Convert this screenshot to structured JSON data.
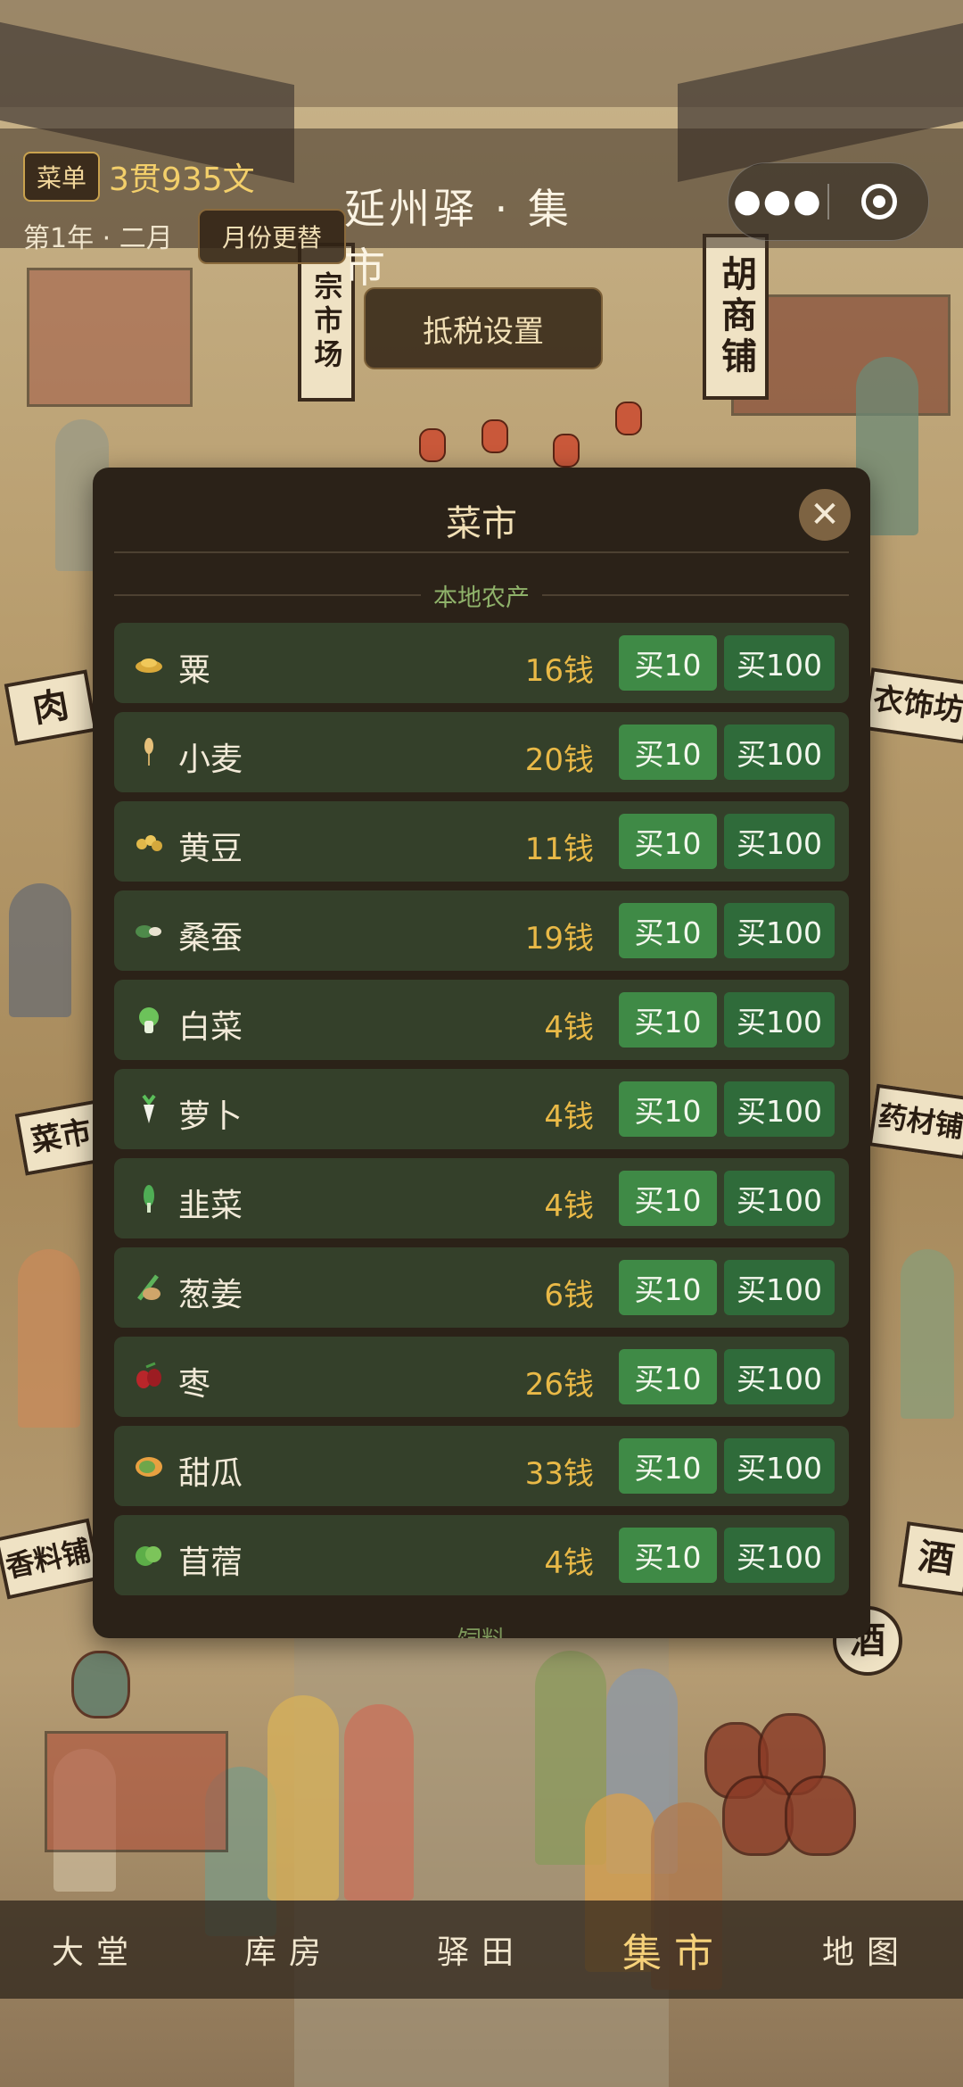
{
  "header": {
    "menu_label": "菜单",
    "money": "3贯935文",
    "date": "第1年 · 二月",
    "month_button": "月份更替",
    "title": "延州驿 · 集 市",
    "more_icon": "more-dots-icon",
    "target_icon": "record-target-icon"
  },
  "tax_button": "抵税设置",
  "background_signs": [
    "宗市场",
    "胡商铺",
    "肉",
    "衣饰坊",
    "菜市",
    "药材铺",
    "香料铺",
    "酒",
    "酒"
  ],
  "modal": {
    "title": "菜市",
    "close_icon": "close-icon",
    "section_local": "本地农产",
    "section_feed": "饲料",
    "buy10_label": "买10",
    "buy100_label": "买100",
    "items": [
      {
        "name": "粟",
        "price": "16钱",
        "icon": "millet-icon"
      },
      {
        "name": "小麦",
        "price": "20钱",
        "icon": "wheat-icon"
      },
      {
        "name": "黄豆",
        "price": "11钱",
        "icon": "soybean-icon"
      },
      {
        "name": "桑蚕",
        "price": "19钱",
        "icon": "silkworm-icon"
      },
      {
        "name": "白菜",
        "price": "4钱",
        "icon": "cabbage-icon"
      },
      {
        "name": "萝卜",
        "price": "4钱",
        "icon": "radish-icon"
      },
      {
        "name": "韭菜",
        "price": "4钱",
        "icon": "chive-icon"
      },
      {
        "name": "葱姜",
        "price": "6钱",
        "icon": "scallion-ginger-icon"
      },
      {
        "name": "枣",
        "price": "26钱",
        "icon": "jujube-icon"
      },
      {
        "name": "甜瓜",
        "price": "33钱",
        "icon": "melon-icon"
      },
      {
        "name": "苜蓿",
        "price": "4钱",
        "icon": "alfalfa-icon"
      }
    ]
  },
  "nav": [
    {
      "label": "大堂",
      "active": false
    },
    {
      "label": "库房",
      "active": false
    },
    {
      "label": "驿田",
      "active": false
    },
    {
      "label": "集市",
      "active": true
    },
    {
      "label": "地图",
      "active": false
    }
  ],
  "colors": {
    "accent_gold": "#e9b947",
    "buy_green": "#3f8a46",
    "section_green": "#8fb26a",
    "panel_bg": "#2b2218"
  }
}
